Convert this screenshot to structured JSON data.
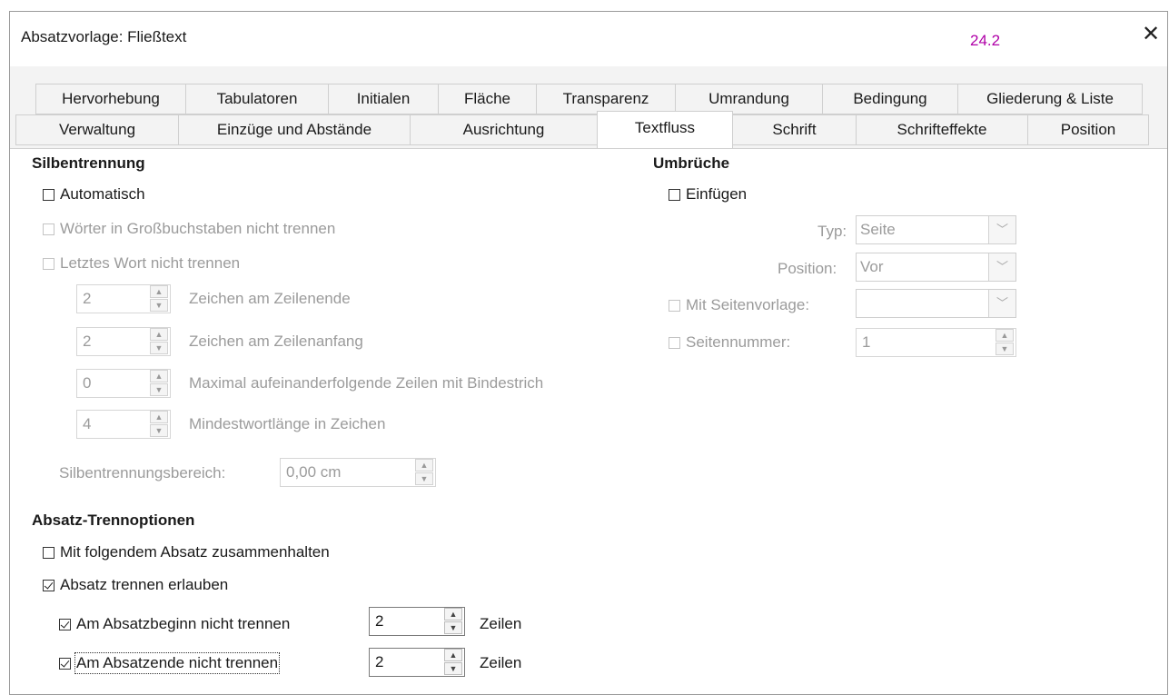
{
  "window": {
    "title": "Absatzvorlage: Fließtext",
    "version_badge": "24.2",
    "close_glyph": "✕"
  },
  "tabs_row1": [
    {
      "label": "Hervorhebung"
    },
    {
      "label": "Tabulatoren"
    },
    {
      "label": "Initialen"
    },
    {
      "label": "Fläche"
    },
    {
      "label": "Transparenz"
    },
    {
      "label": "Umrandung"
    },
    {
      "label": "Bedingung"
    },
    {
      "label": "Gliederung & Liste"
    }
  ],
  "tabs_row2": [
    {
      "label": "Verwaltung"
    },
    {
      "label": "Einzüge und Abstände"
    },
    {
      "label": "Ausrichtung"
    },
    {
      "label": "Textfluss",
      "active": true
    },
    {
      "label": "Schrift"
    },
    {
      "label": "Schrifteffekte"
    },
    {
      "label": "Position"
    }
  ],
  "hyphenation": {
    "heading": "Silbentrennung",
    "automatic": {
      "label": "Automatisch",
      "checked": false
    },
    "no_caps": {
      "label": "Wörter in Großbuchstaben nicht trennen",
      "checked": false
    },
    "no_last_word": {
      "label": "Letztes Wort nicht trennen",
      "checked": false
    },
    "chars_line_end": {
      "value": "2",
      "label": "Zeichen am Zeilenende"
    },
    "chars_line_begin": {
      "value": "2",
      "label": "Zeichen am Zeilenanfang"
    },
    "max_consecutive": {
      "value": "0",
      "label": "Maximal aufeinanderfolgende Zeilen mit Bindestrich"
    },
    "min_word_length": {
      "value": "4",
      "label": "Mindestwortlänge in Zeichen"
    },
    "zone": {
      "label": "Silbentrennungsbereich:",
      "value": "0,00 cm"
    }
  },
  "breaks": {
    "heading": "Umbrüche",
    "insert": {
      "label": "Einfügen",
      "checked": false
    },
    "type": {
      "label": "Typ:",
      "value": "Seite"
    },
    "position": {
      "label": "Position:",
      "value": "Vor"
    },
    "with_page_style": {
      "label": "Mit Seitenvorlage:",
      "value": ""
    },
    "page_number": {
      "label": "Seitennummer:",
      "value": "1"
    }
  },
  "split_options": {
    "heading": "Absatz-Trennoptionen",
    "keep_with_next": {
      "label": "Mit folgendem Absatz zusammenhalten",
      "checked": false
    },
    "allow_split": {
      "label": "Absatz trennen erlauben",
      "checked": true
    },
    "orphan": {
      "label": "Am Absatzbeginn nicht trennen",
      "checked": true,
      "value": "2",
      "unit": "Zeilen"
    },
    "widow": {
      "label": "Am Absatzende nicht trennen",
      "checked": true,
      "value": "2",
      "unit": "Zeilen"
    }
  }
}
